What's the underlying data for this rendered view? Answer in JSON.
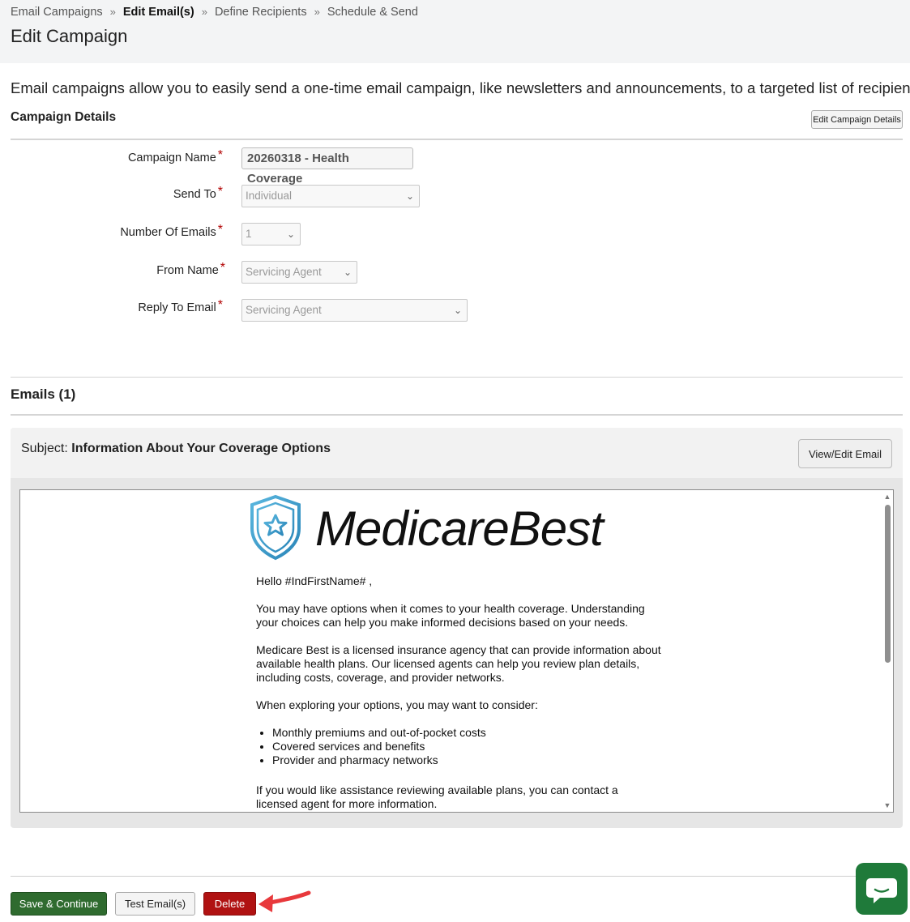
{
  "breadcrumb": {
    "items": [
      "Email Campaigns",
      "Edit Email(s)",
      "Define Recipients",
      "Schedule & Send"
    ],
    "separator": "»"
  },
  "page": {
    "title": "Edit Campaign",
    "intro": "Email campaigns allow you to easily send a one-time email campaign, like newsletters and announcements, to a targeted list of recipients."
  },
  "campaign_details": {
    "title": "Campaign Details",
    "edit_button": "Edit Campaign Details",
    "fields": {
      "campaign_name": {
        "label": "Campaign Name",
        "value": "20260318 - Health Coverage"
      },
      "send_to": {
        "label": "Send To",
        "value": "Individual"
      },
      "number_of_emails": {
        "label": "Number Of Emails",
        "value": "1"
      },
      "from_name": {
        "label": "From Name",
        "value": "Servicing Agent"
      },
      "reply_to_email": {
        "label": "Reply To Email",
        "value": "Servicing Agent"
      }
    },
    "required_marker": "*"
  },
  "emails": {
    "title": "Emails (1)",
    "subject_label": "Subject:",
    "subject": "Information About Your Coverage Options",
    "view_edit_button": "View/Edit Email",
    "preview": {
      "logo_text_1": "Medicare",
      "logo_text_2": "Best",
      "greeting": "Hello #IndFirstName# ,",
      "p1": "You may have options when it comes to your health coverage. Understanding your choices can help you make informed decisions based on your needs.",
      "p2": "Medicare Best is a licensed insurance agency that can provide information about available health plans. Our licensed agents can help you review plan details, including costs, coverage, and provider networks.",
      "p3": "When exploring your options, you may want to consider:",
      "bullets": [
        "Monthly premiums and out-of-pocket costs",
        "Covered services and benefits",
        "Provider and pharmacy networks"
      ],
      "p4": "If you would like assistance reviewing available plans, you can contact a licensed agent for more information."
    }
  },
  "actions": {
    "save_continue": "Save & Continue",
    "test_emails": "Test Email(s)",
    "delete": "Delete"
  },
  "colors": {
    "save": "#2f6b2f",
    "delete": "#b01212",
    "chat": "#1f7a3a",
    "required": "#b10000",
    "arrow": "#e8393c"
  },
  "icons": [
    "chat-icon",
    "chevron-down-icon",
    "shield-star-icon",
    "arrow-pointer-icon"
  ]
}
